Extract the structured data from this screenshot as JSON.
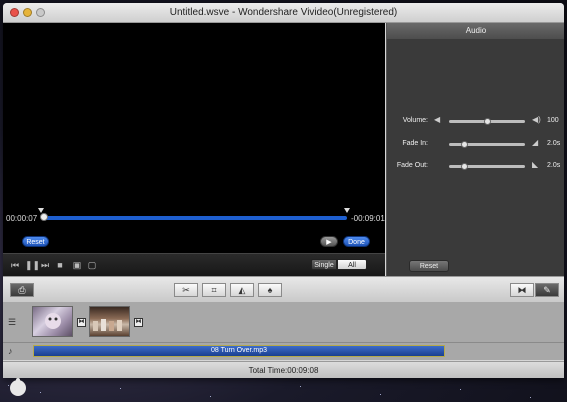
{
  "window": {
    "title": "Untitled.wsve - Wondershare Vivideo(Unregistered)"
  },
  "player": {
    "current_time": "00:00:07",
    "remaining_time": "-00:09:01",
    "progress": 0.01,
    "reset_label": "Reset",
    "done_label": "Done",
    "play_preview_icon": "play-icon"
  },
  "playback_controls": [
    {
      "name": "skip-back-icon",
      "glyph": "⏮"
    },
    {
      "name": "pause-icon",
      "glyph": "❚❚"
    },
    {
      "name": "skip-forward-icon",
      "glyph": "⏭"
    },
    {
      "name": "stop-icon",
      "glyph": "■"
    },
    {
      "name": "snapshot-icon",
      "glyph": "▣"
    },
    {
      "name": "fullscreen-icon",
      "glyph": "▢"
    }
  ],
  "view_mode": {
    "single_label": "Single",
    "all_label": "All",
    "selected": "All"
  },
  "audio_panel": {
    "title": "Audio",
    "volume": {
      "label": "Volume:",
      "value": "100",
      "level": 0.5
    },
    "fade_in": {
      "label": "Fade In:",
      "value": "2.0s",
      "level": 0.2
    },
    "fade_out": {
      "label": "Fade Out:",
      "value": "2.0s",
      "level": 0.2
    },
    "reset_label": "Reset"
  },
  "toolbar": {
    "tools": [
      {
        "name": "trim-icon",
        "glyph": "✂"
      },
      {
        "name": "crop-icon",
        "glyph": "⌗"
      },
      {
        "name": "effect-icon",
        "glyph": "◭"
      },
      {
        "name": "voiceover-icon",
        "glyph": "♠"
      }
    ],
    "right_tools": [
      {
        "name": "transition-icon",
        "glyph": "⧓"
      },
      {
        "name": "edit-icon",
        "glyph": "✎"
      }
    ],
    "import_icon": "camera-icon"
  },
  "timeline": {
    "audio_clip_label": "08 Turn Over.mp3"
  },
  "status": {
    "total_time": "Total Time:00:09:08"
  },
  "colors": {
    "accent_blue": "#1e5fd0",
    "panel_bg": "#3a3a3a",
    "audio_clip": "#2d5bb5"
  }
}
